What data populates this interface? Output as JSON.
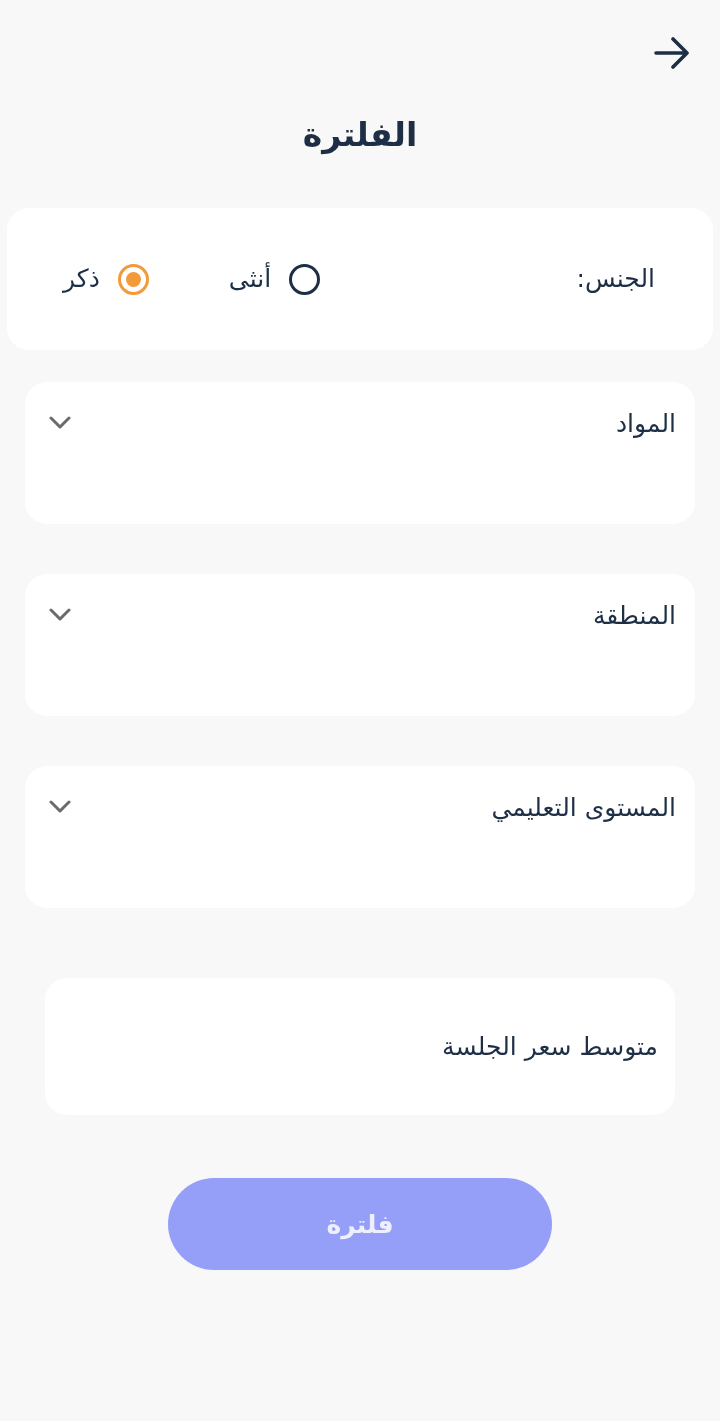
{
  "header": {
    "title": "الفلترة"
  },
  "gender": {
    "label": "الجنس:",
    "options": [
      {
        "label": "أنثى",
        "selected": false
      },
      {
        "label": "ذكر",
        "selected": true
      }
    ]
  },
  "dropdowns": [
    {
      "label": "المواد"
    },
    {
      "label": "المنطقة"
    },
    {
      "label": "المستوى التعليمي"
    }
  ],
  "price_field": {
    "label": "متوسط سعر الجلسة"
  },
  "submit_button": {
    "label": "فلترة"
  }
}
